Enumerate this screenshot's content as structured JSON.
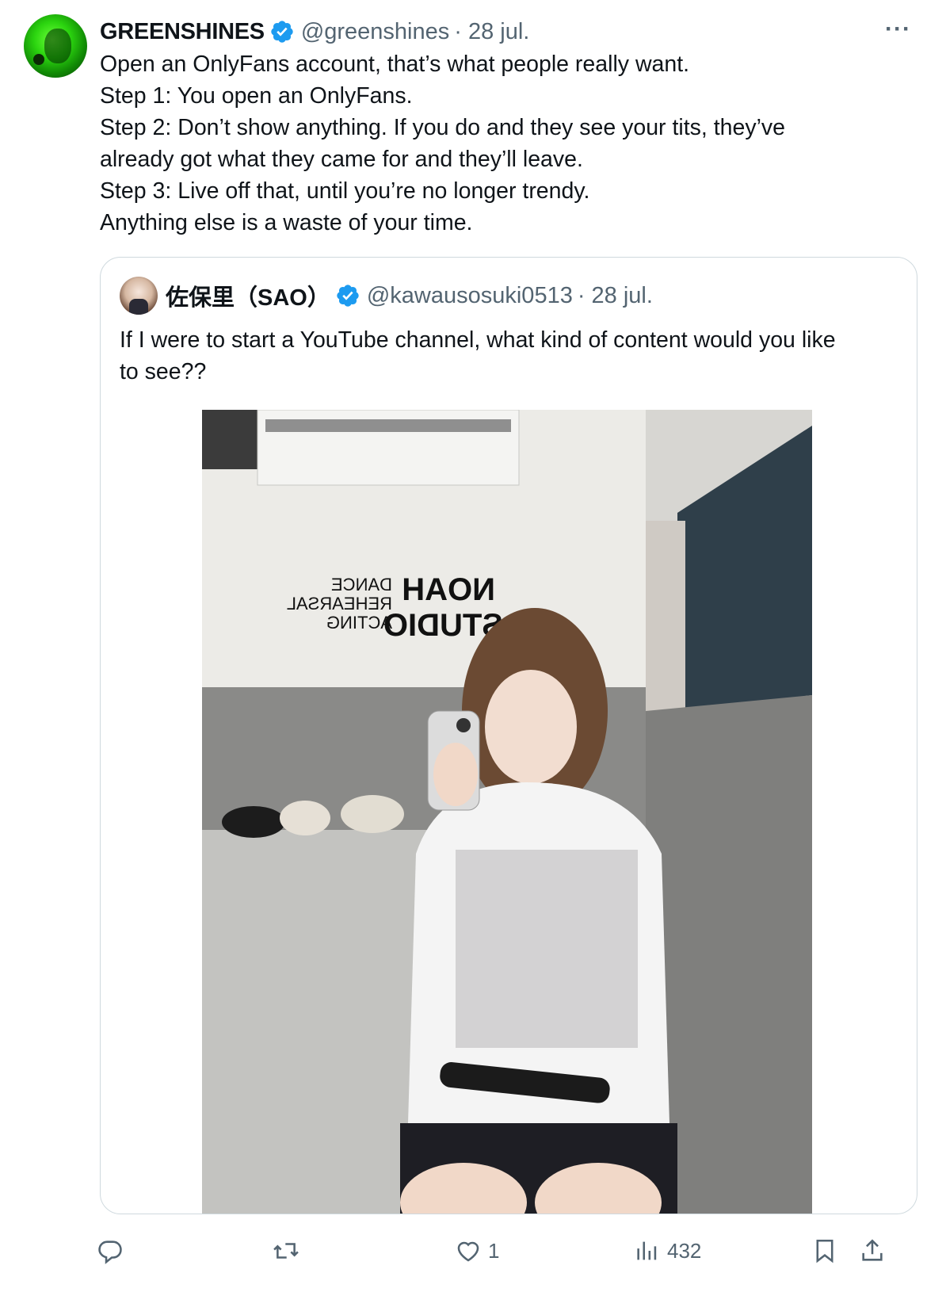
{
  "author": {
    "name": "GREENSHINES",
    "handle": "@greenshines",
    "date": "· 28 jul.",
    "verified": true
  },
  "more_label": "···",
  "tweet": {
    "lines": [
      "Open an OnlyFans account, that’s what people really want.",
      "Step 1: You open an OnlyFans.",
      "Step 2: Don’t show anything. If you do and they see your tits, they’ve",
      "already got what they came for and they’ll leave.",
      "Step 3: Live off that, until you’re no longer trendy.",
      "Anything else is a waste of your time."
    ]
  },
  "quoted": {
    "name": "佐保里（SAO）",
    "handle": "@kawausosuki0513",
    "date": "· 28 jul.",
    "verified": true,
    "text_lines": [
      "If I were to start a YouTube channel, what kind of content would you like",
      "to see??"
    ],
    "photo": {
      "wall_sign_1": "NOAH",
      "wall_sign_2": "STUDIO",
      "wall_sign_3": "DANCE",
      "wall_sign_4": "REHEARSAL",
      "wall_sign_5": "ACTING"
    }
  },
  "actions": {
    "reply_count": "",
    "repost_count": "",
    "like_count": "1",
    "views_count": "432"
  },
  "colors": {
    "text": "#0f1419",
    "secondary": "#536471",
    "verified": "#1d9bf0",
    "border": "#cfd9de"
  }
}
